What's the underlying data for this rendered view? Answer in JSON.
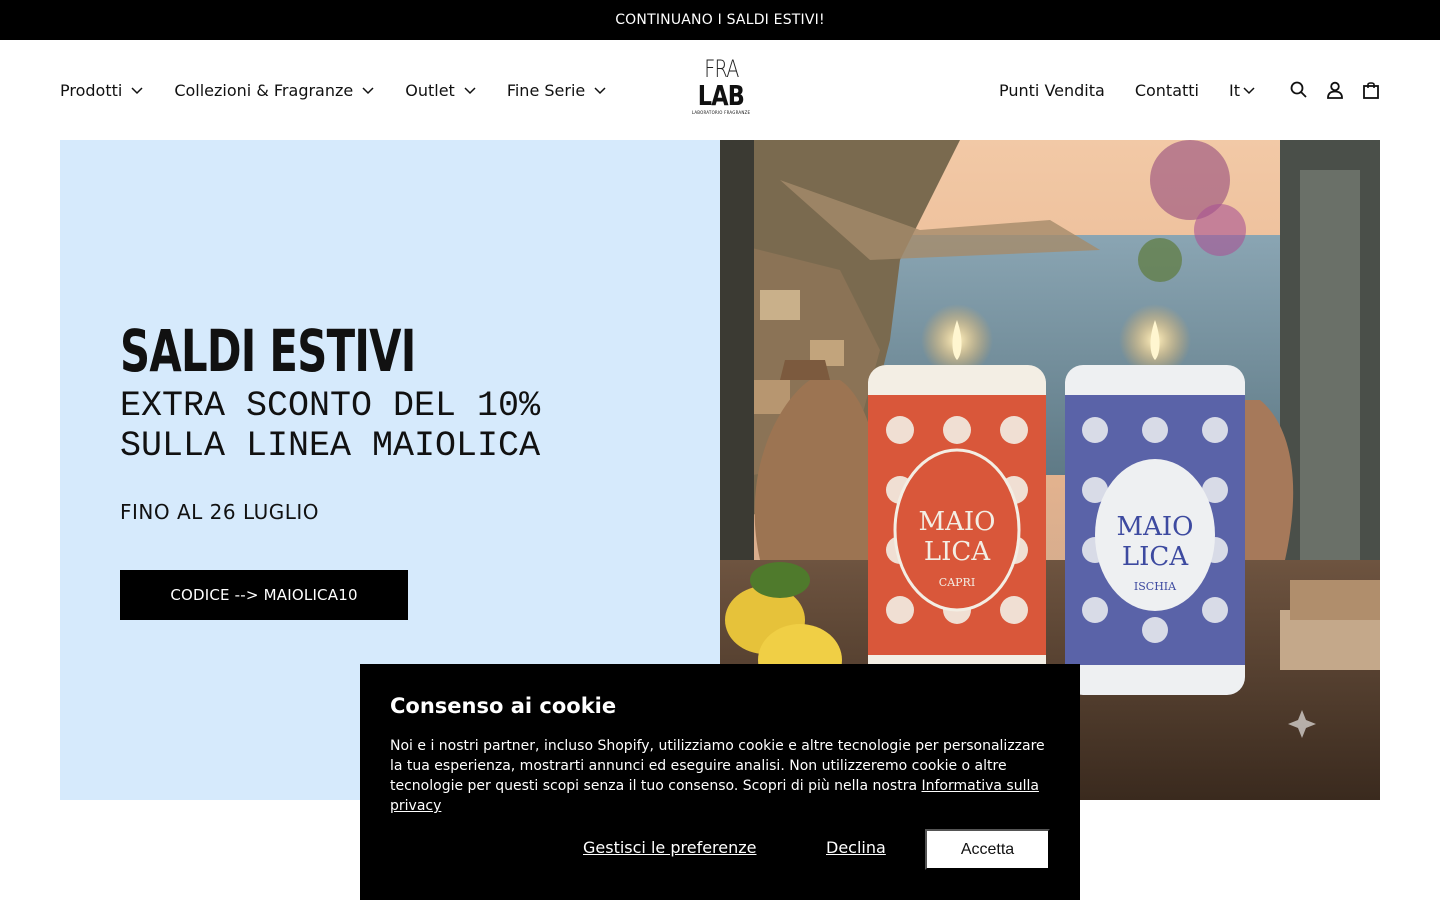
{
  "announcement": {
    "text": "CONTINUANO I SALDI ESTIVI!"
  },
  "nav": {
    "left": [
      {
        "label": "Prodotti"
      },
      {
        "label": "Collezioni & Fragranze"
      },
      {
        "label": "Outlet"
      },
      {
        "label": "Fine Serie"
      }
    ],
    "right": {
      "stores": "Punti Vendita",
      "contacts": "Contatti",
      "language": "It"
    },
    "icons": [
      "search-icon",
      "account-icon",
      "cart-icon"
    ]
  },
  "logo": {
    "line1": "FRA",
    "line2": "LAB",
    "tagline": "LABORATORIO FRAGRANZE"
  },
  "hero": {
    "title": "SALDI ESTIVI",
    "subtitle_line1": "EXTRA SCONTO DEL 10%",
    "subtitle_line2": "SULLA LINEA MAIOLICA",
    "date": "FINO AL 26 LUGLIO",
    "cta": "CODICE --> MAIOLICA10",
    "background": "#d6eafc",
    "image": {
      "candle_left_label1": "MAIO",
      "candle_left_label2": "LICA",
      "candle_left_name": "CAPRI",
      "candle_right_label1": "MAIO",
      "candle_right_label2": "LICA",
      "candle_right_name": "ISCHIA"
    }
  },
  "cookie": {
    "title": "Consenso ai cookie",
    "text": "Noi e i nostri partner, incluso Shopify, utilizziamo cookie e altre tecnologie per personalizzare la tua esperienza, mostrarti annunci ed eseguire analisi. Non utilizzeremo cookie o altre tecnologie per questi scopi senza il tuo consenso. Scopri di più nella nostra ",
    "privacy_link": "Informativa sulla privacy",
    "manage": "Gestisci le preferenze",
    "decline": "Declina",
    "accept": "Accetta"
  }
}
